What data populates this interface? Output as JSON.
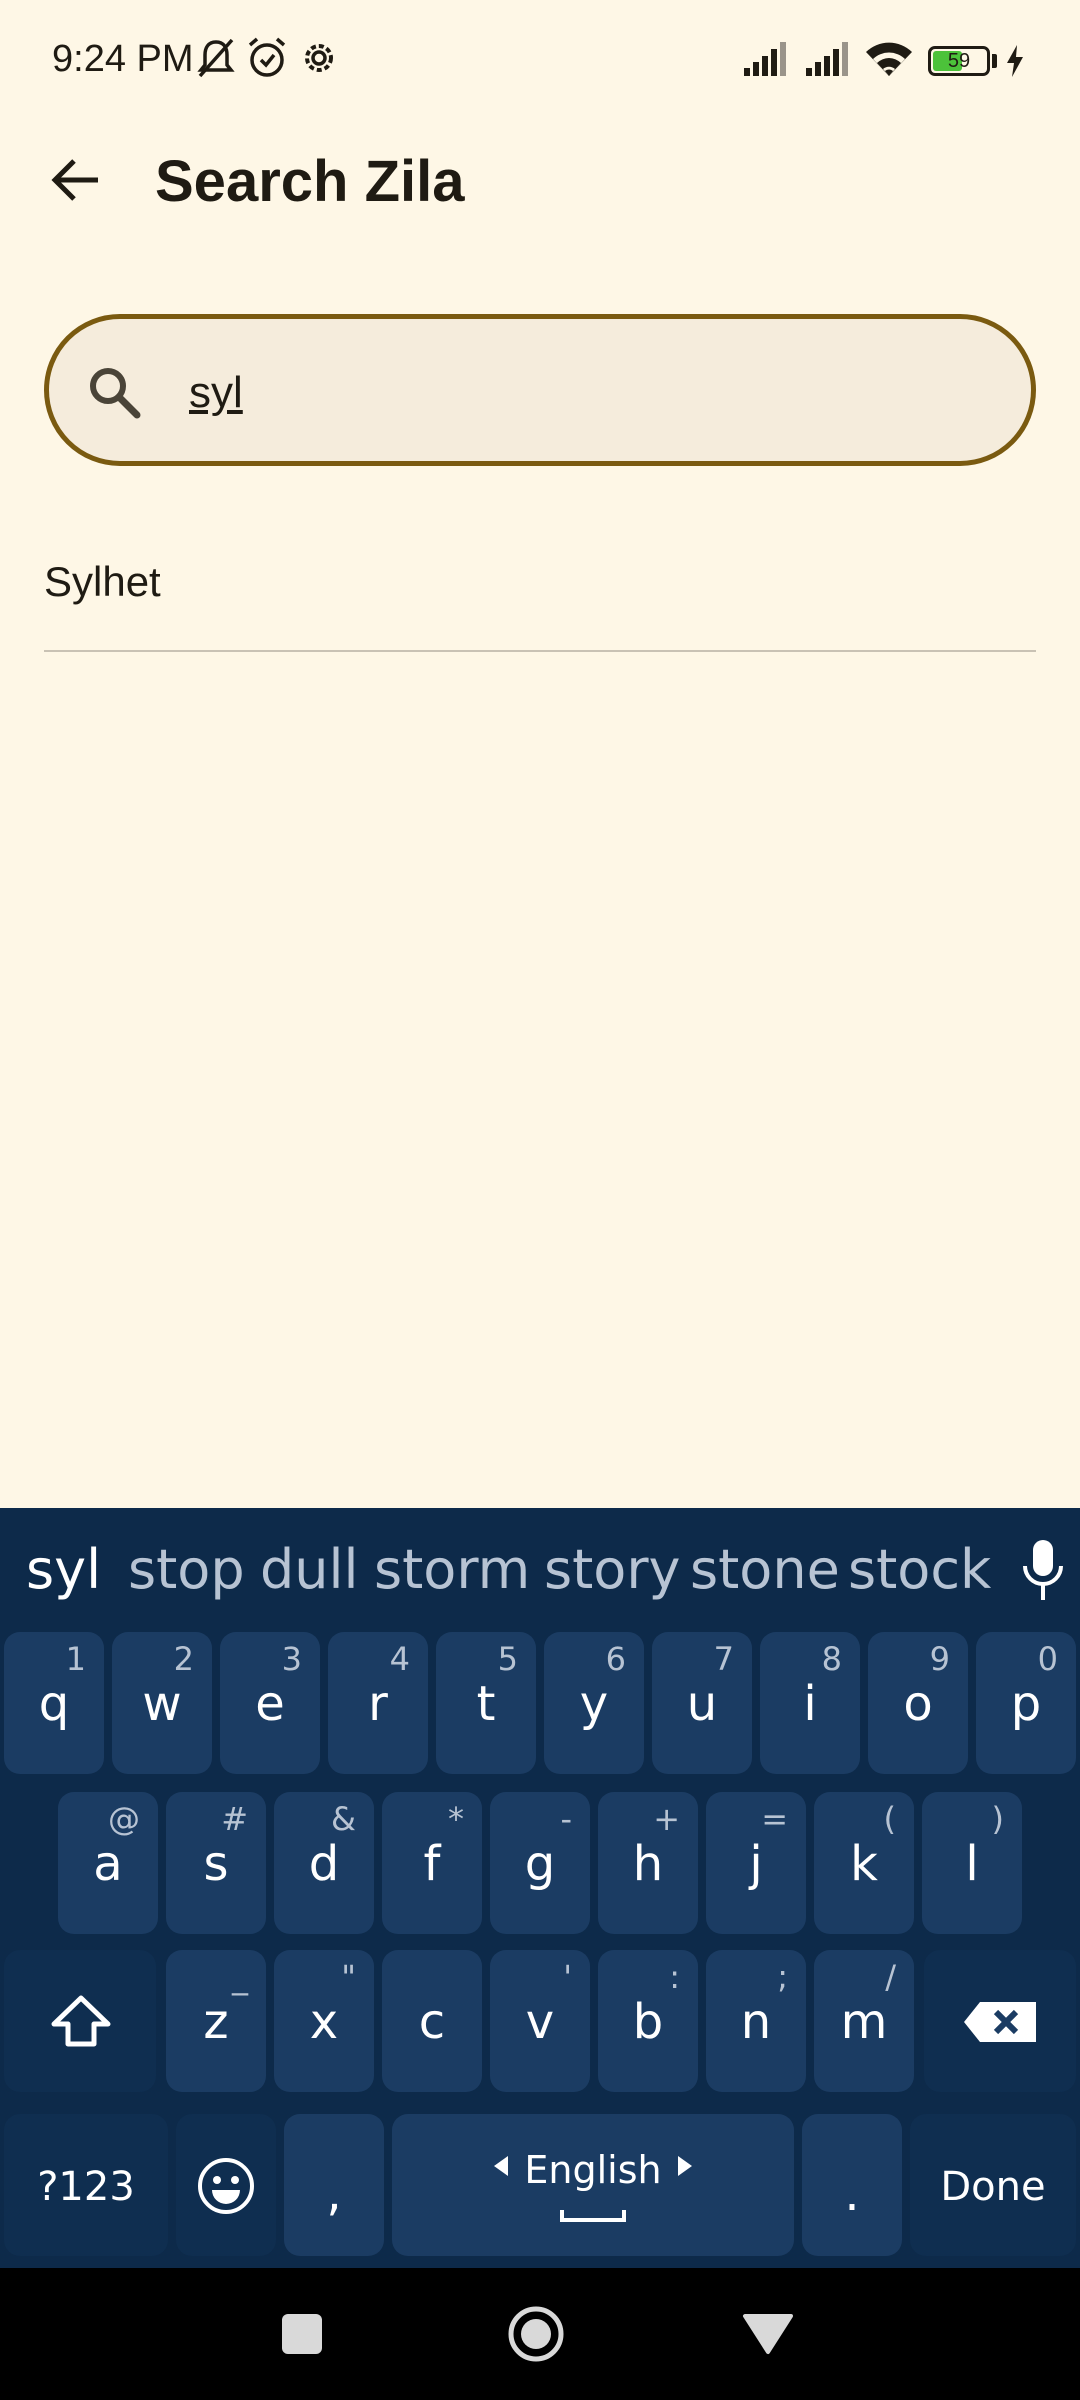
{
  "status_bar": {
    "time": "9:24 PM",
    "battery_percent": "59",
    "battery_level": 0.59,
    "icons": [
      "mute-icon",
      "alarm-icon",
      "settings-icon",
      "signal-1-icon",
      "signal-2-icon",
      "wifi-icon",
      "battery-icon",
      "charging-icon"
    ]
  },
  "app_bar": {
    "title": "Search Zila",
    "back_icon": "arrow-left-icon"
  },
  "search": {
    "value": "syl",
    "icon": "search-icon"
  },
  "results": [
    {
      "label": "Sylhet"
    }
  ],
  "keyboard": {
    "suggestions": [
      "syl",
      "stop",
      "dull",
      "storm",
      "story",
      "stone",
      "stock"
    ],
    "row1": [
      {
        "key": "q",
        "hint": "1"
      },
      {
        "key": "w",
        "hint": "2"
      },
      {
        "key": "e",
        "hint": "3"
      },
      {
        "key": "r",
        "hint": "4"
      },
      {
        "key": "t",
        "hint": "5"
      },
      {
        "key": "y",
        "hint": "6"
      },
      {
        "key": "u",
        "hint": "7"
      },
      {
        "key": "i",
        "hint": "8"
      },
      {
        "key": "o",
        "hint": "9"
      },
      {
        "key": "p",
        "hint": "0"
      }
    ],
    "row2": [
      {
        "key": "a",
        "hint": "@"
      },
      {
        "key": "s",
        "hint": "#"
      },
      {
        "key": "d",
        "hint": "&"
      },
      {
        "key": "f",
        "hint": "*"
      },
      {
        "key": "g",
        "hint": "-"
      },
      {
        "key": "h",
        "hint": "+"
      },
      {
        "key": "j",
        "hint": "="
      },
      {
        "key": "k",
        "hint": "("
      },
      {
        "key": "l",
        "hint": ")"
      }
    ],
    "row3": [
      {
        "key": "z",
        "hint": "_"
      },
      {
        "key": "x",
        "hint": "\""
      },
      {
        "key": "c",
        "hint": ""
      },
      {
        "key": "v",
        "hint": "'"
      },
      {
        "key": "b",
        "hint": ":"
      },
      {
        "key": "n",
        "hint": ";"
      },
      {
        "key": "m",
        "hint": "/"
      }
    ],
    "symbols_label": "?123",
    "comma_label": ",",
    "space_label": "English",
    "period_label": ".",
    "done_label": "Done",
    "colors": {
      "background": "#0d2a4a",
      "key": "#1b3c63"
    }
  },
  "nav_bar": {
    "icons": [
      "recents-square-icon",
      "home-circle-icon",
      "back-triangle-icon"
    ]
  },
  "colors": {
    "page_background": "#fef7e6",
    "search_border": "#7a5a10",
    "search_fill": "#f5ecdc"
  }
}
